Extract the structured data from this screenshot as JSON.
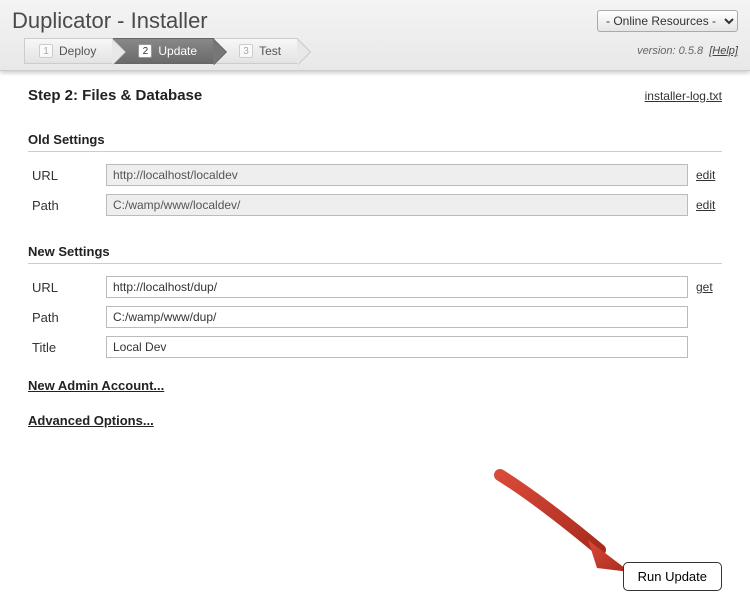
{
  "header": {
    "title": "Duplicator - Installer",
    "resources_dropdown": "- Online Resources -",
    "version_label": "version:",
    "version": "0.5.8",
    "help_label": "[Help]"
  },
  "wizard": {
    "steps": [
      {
        "num": "1",
        "label": "Deploy",
        "active": false
      },
      {
        "num": "2",
        "label": "Update",
        "active": true
      },
      {
        "num": "3",
        "label": "Test",
        "active": false
      }
    ]
  },
  "main": {
    "step_heading": "Step 2: Files & Database",
    "log_link": "installer-log.txt",
    "old_section_title": "Old Settings",
    "old_fields": {
      "url_label": "URL",
      "url_value": "http://localhost/localdev",
      "url_action": "edit",
      "path_label": "Path",
      "path_value": "C:/wamp/www/localdev/",
      "path_action": "edit"
    },
    "new_section_title": "New Settings",
    "new_fields": {
      "url_label": "URL",
      "url_value": "http://localhost/dup/",
      "url_action": "get",
      "path_label": "Path",
      "path_value": "C:/wamp/www/dup/",
      "title_label": "Title",
      "title_value": "Local Dev"
    },
    "new_admin_link": "New Admin Account...",
    "advanced_link": "Advanced Options...",
    "run_button": "Run Update"
  }
}
